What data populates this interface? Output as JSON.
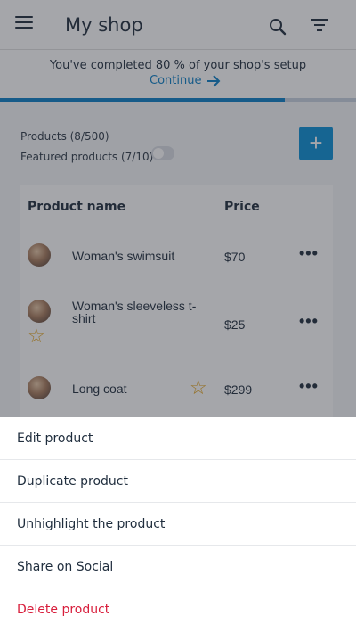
{
  "header": {
    "title": "My shop",
    "menu_icon": "menu-icon",
    "search_icon": "search-icon",
    "filter_icon": "filter-icon"
  },
  "setup": {
    "text": "You've completed 80 % of your shop's setup",
    "link": "Continue",
    "progress": 0.8
  },
  "stats": {
    "products": "Products (8/500)",
    "featured": "Featured products (7/10)"
  },
  "add_label": "+",
  "table": {
    "headers": {
      "name": "Product name",
      "price": "Price"
    },
    "rows": [
      {
        "name": "Woman's swimsuit",
        "price": "$70",
        "featured": false,
        "menu": "•••"
      },
      {
        "name": "Woman's sleeveless t-shirt",
        "price": "$25",
        "featured": true,
        "menu": "•••"
      },
      {
        "name": "Long coat",
        "price": "$299",
        "featured": true,
        "menu": "•••"
      }
    ]
  },
  "sheet": {
    "items": [
      {
        "label": "Edit product"
      },
      {
        "label": "Duplicate product"
      },
      {
        "label": "Unhighlight the product"
      },
      {
        "label": "Share on Social"
      },
      {
        "label": "Delete product",
        "danger": true
      }
    ]
  },
  "colors": {
    "accent": "#0a7fc6",
    "danger": "#d81e3c",
    "star": "#e3a21a"
  }
}
